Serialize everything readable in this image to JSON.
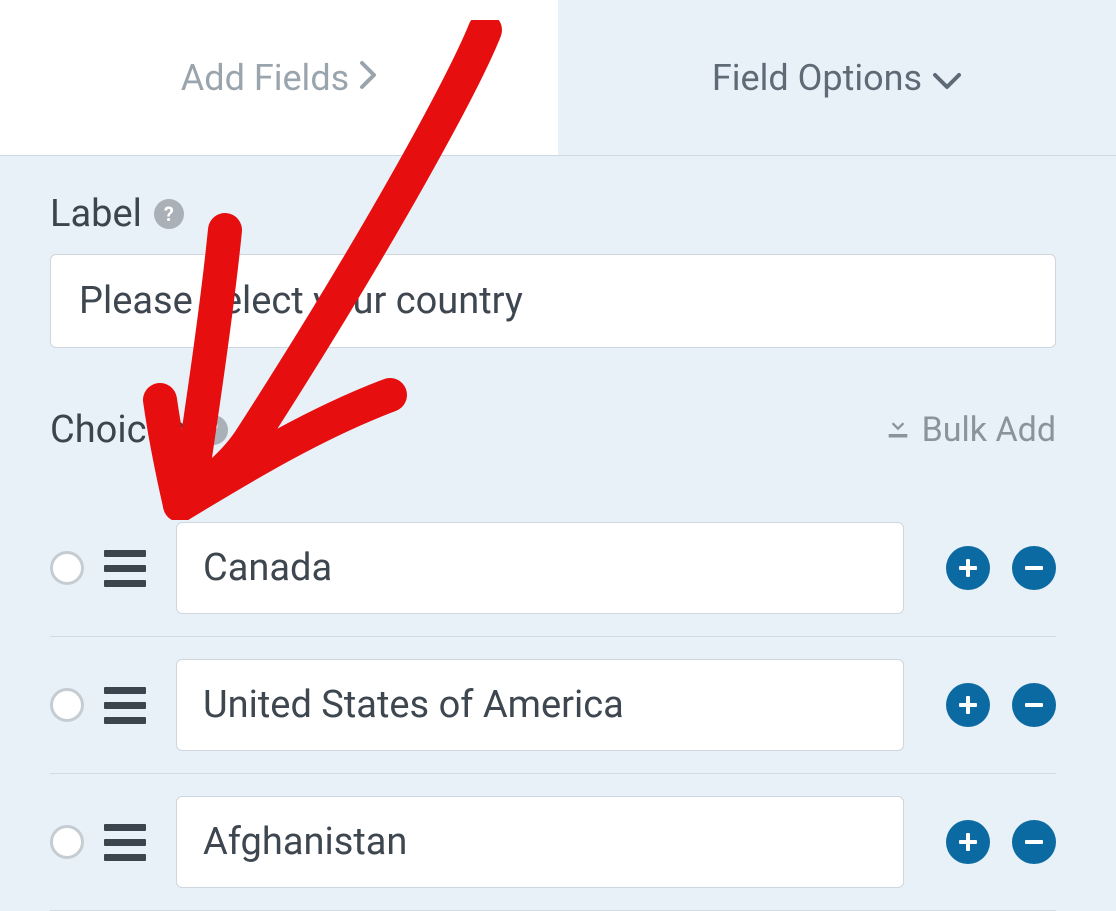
{
  "tabs": {
    "addFields": "Add Fields",
    "fieldOptions": "Field Options"
  },
  "labelSection": {
    "title": "Label",
    "value": "Please select your country"
  },
  "choicesSection": {
    "title": "Choices",
    "bulkAdd": "Bulk Add",
    "items": [
      {
        "value": "Canada"
      },
      {
        "value": "United States of America"
      },
      {
        "value": "Afghanistan"
      }
    ]
  }
}
